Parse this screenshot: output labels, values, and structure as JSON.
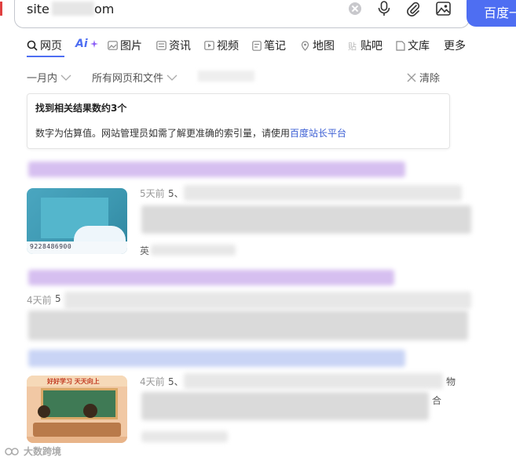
{
  "search": {
    "query_prefix": "site",
    "query_suffix": "om",
    "button_label": "百度一"
  },
  "tabs": [
    {
      "label": "网页",
      "active": true
    },
    {
      "label": "Ai"
    },
    {
      "label": "图片"
    },
    {
      "label": "资讯"
    },
    {
      "label": "视频"
    },
    {
      "label": "笔记"
    },
    {
      "label": "地图"
    },
    {
      "label": "贴吧"
    },
    {
      "label": "文库"
    },
    {
      "label": "更多"
    }
  ],
  "filters": {
    "time": "一月内",
    "scope": "所有网页和文件",
    "clear": "清除"
  },
  "info_card": {
    "title": "找到相关结果数约3个",
    "desc_prefix": "数字为估算值。网站管理员如需了解更准确的索引量，请使用",
    "desc_link": "百度站长平台"
  },
  "results": [
    {
      "time": "5天前",
      "snippet_start": "5、",
      "thumb_text": "9228486900",
      "footer_start": "英"
    },
    {
      "time": "4天前",
      "snippet_start": "5"
    },
    {
      "time": "4天前",
      "snippet_start": "5、",
      "snippet_tail": "物",
      "line2_tail": "合",
      "thumb_title": "好好学习 天天向上"
    }
  ],
  "watermark": "大数跨境",
  "colors": {
    "accent": "#4e6ef2",
    "link": "#3c5fd4",
    "title_blur_purple": "#d6bff0",
    "title_blur_blue": "#c9d4f5"
  }
}
